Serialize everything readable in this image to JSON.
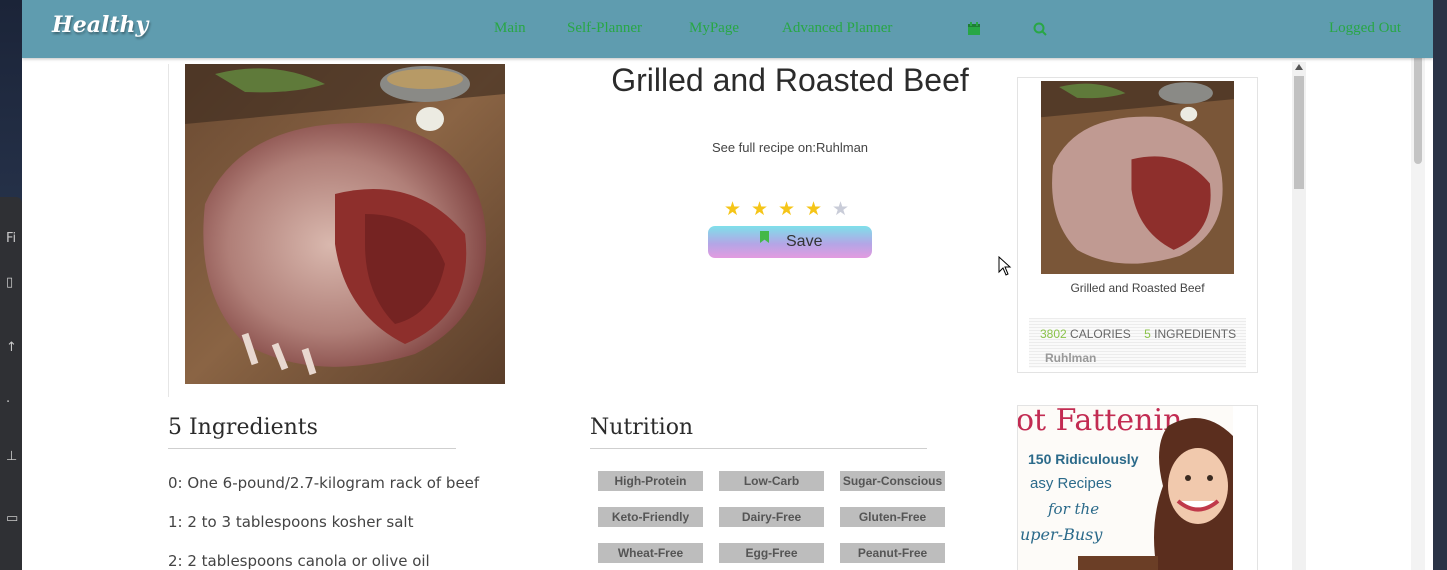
{
  "desktop": {
    "side_labels": [
      "Fi"
    ]
  },
  "navbar": {
    "logo": "Healthy",
    "links": [
      "Main",
      "Self-Planner",
      "MyPage",
      "Advanced Planner"
    ],
    "logged_out": "Logged Out",
    "icons": [
      "calendar-icon",
      "search-icon"
    ],
    "link_color": "#28a745",
    "background": "#5f9caf"
  },
  "recipe": {
    "title": "Grilled and Roasted Beef",
    "source_prefix": "See full recipe on:",
    "source_name": "Ruhlman",
    "rating": 4,
    "rating_max": 5,
    "save_label": "Save"
  },
  "ingredients": {
    "heading": "5 Ingredients",
    "items": [
      "0: One 6-pound/2.7-kilogram rack of beef",
      "1: 2 to 3 tablespoons kosher salt",
      "2: 2 tablespoons canola or olive oil"
    ]
  },
  "nutrition": {
    "heading": "Nutrition",
    "tags": [
      "High-Protein",
      "Low-Carb",
      "Sugar-Conscious",
      "Keto-Friendly",
      "Dairy-Free",
      "Gluten-Free",
      "Wheat-Free",
      "Egg-Free",
      "Peanut-Free"
    ]
  },
  "card": {
    "title": "Grilled and Roasted Beef",
    "calories": "3802",
    "calories_label": "CALORIES",
    "ingredients": "5",
    "ingredients_label": "INGREDIENTS",
    "source": "Ruhlman"
  },
  "ad": {
    "headline": "ot Fattenin",
    "lines": [
      "150 Ridiculously",
      "asy Recipes",
      "for the",
      "uper-Busy"
    ]
  }
}
